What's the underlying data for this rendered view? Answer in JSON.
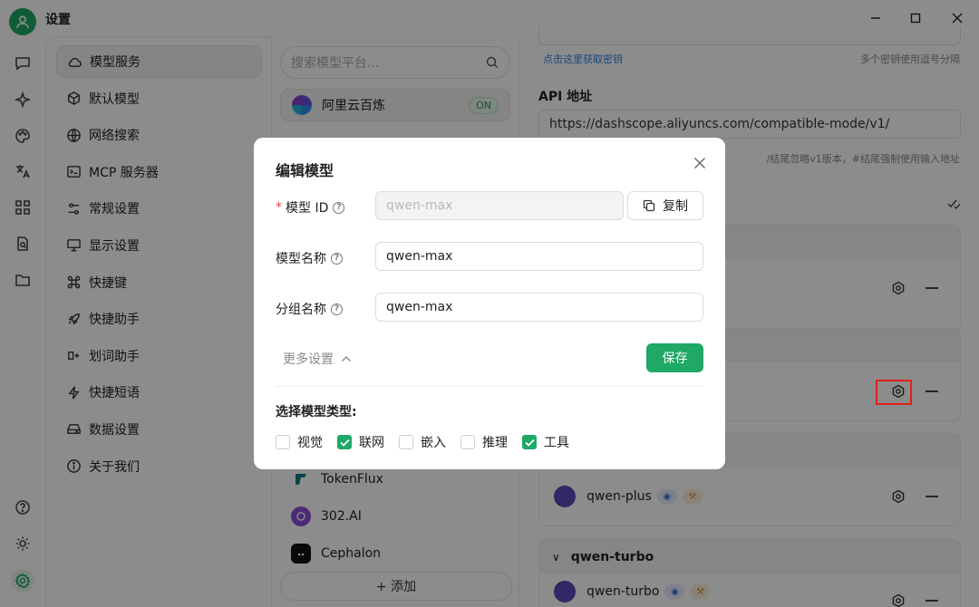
{
  "app": {
    "title": "设置"
  },
  "nav": {
    "items": [
      {
        "label": "模型服务",
        "icon": "cloud-icon",
        "active": true
      },
      {
        "label": "默认模型",
        "icon": "cube-icon"
      },
      {
        "label": "网络搜索",
        "icon": "globe-icon"
      },
      {
        "label": "MCP 服务器",
        "icon": "terminal-icon"
      },
      {
        "label": "常规设置",
        "icon": "sliders-icon"
      },
      {
        "label": "显示设置",
        "icon": "monitor-icon"
      },
      {
        "label": "快捷键",
        "icon": "command-icon"
      },
      {
        "label": "快捷助手",
        "icon": "rocket-icon"
      },
      {
        "label": "划词助手",
        "icon": "text-select-icon"
      },
      {
        "label": "快捷短语",
        "icon": "zap-icon"
      },
      {
        "label": "数据设置",
        "icon": "hard-drive-icon"
      },
      {
        "label": "关于我们",
        "icon": "info-icon"
      }
    ]
  },
  "providers": {
    "search_placeholder": "搜索模型平台...",
    "items": [
      {
        "name": "阿里云百炼",
        "status": "ON",
        "active": true
      },
      {
        "name": "TokenFlux"
      },
      {
        "name": "302.AI"
      },
      {
        "name": "Cephalon"
      }
    ],
    "add_label": "+ 添加"
  },
  "content": {
    "key_link": "点击这里获取密钥",
    "key_hint": "多个密钥使用逗号分隔",
    "api_label": "API 地址",
    "api_value": "https://dashscope.aliyuncs.com/compatible-mode/v1/",
    "api_hint": "/结尾忽略v1版本，#结尾强制使用输入地址",
    "models": [
      {
        "name": "qwen-plus"
      },
      {
        "name": "qwen-turbo"
      }
    ],
    "group_qwen_turbo": "qwen-turbo"
  },
  "modal": {
    "title": "编辑模型",
    "model_id_label": "模型 ID",
    "model_id_value": "qwen-max",
    "copy_label": "复制",
    "model_name_label": "模型名称",
    "model_name_value": "qwen-max",
    "group_name_label": "分组名称",
    "group_name_value": "qwen-max",
    "more_settings": "更多设置",
    "save_label": "保存",
    "type_label": "选择模型类型:",
    "types": [
      {
        "label": "视觉",
        "checked": false
      },
      {
        "label": "联网",
        "checked": true
      },
      {
        "label": "嵌入",
        "checked": false
      },
      {
        "label": "推理",
        "checked": false
      },
      {
        "label": "工具",
        "checked": true
      }
    ]
  },
  "colors": {
    "accent": "#1fa866",
    "highlight": "#e0201c",
    "link": "#2b7de9"
  }
}
